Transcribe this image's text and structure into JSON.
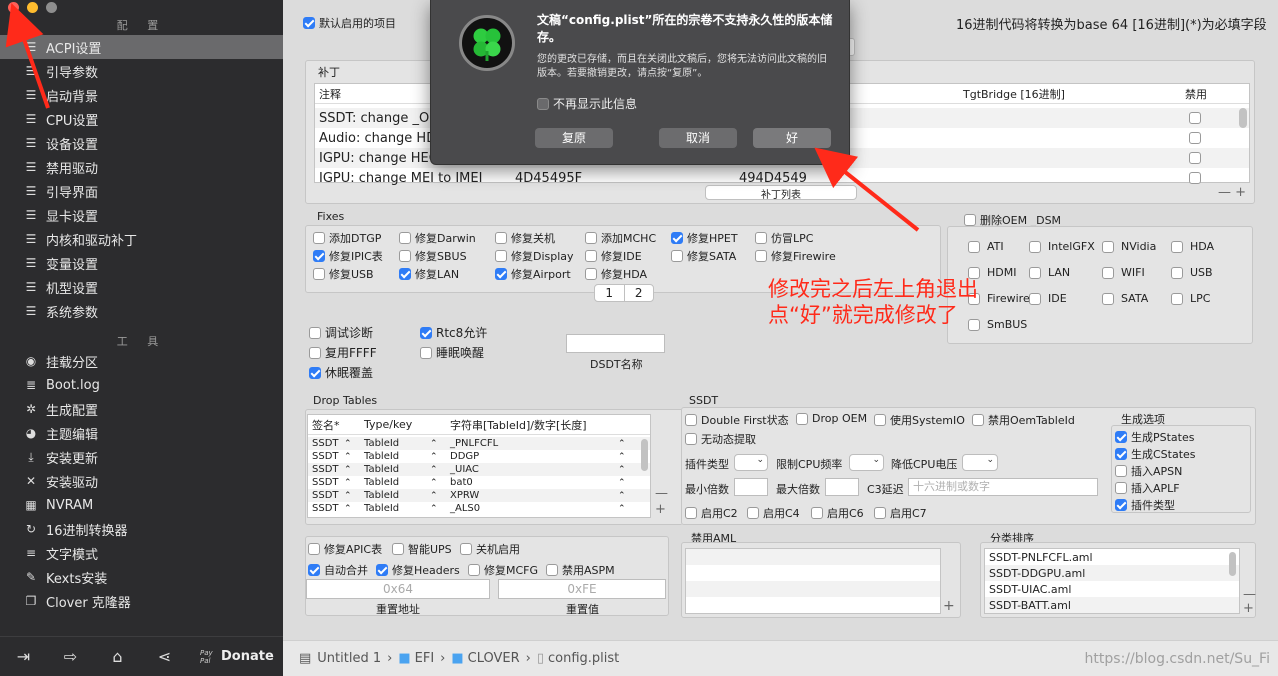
{
  "sidebar": {
    "config_header": "配 置",
    "tools_header": "工 具",
    "config_items": [
      {
        "icon": "list-icon",
        "label": "ACPI设置"
      },
      {
        "icon": "list-icon",
        "label": "引导参数"
      },
      {
        "icon": "list-icon",
        "label": "启动背景"
      },
      {
        "icon": "list-icon",
        "label": "CPU设置"
      },
      {
        "icon": "list-icon",
        "label": "设备设置"
      },
      {
        "icon": "list-icon",
        "label": "禁用驱动"
      },
      {
        "icon": "list-icon",
        "label": "引导界面"
      },
      {
        "icon": "list-icon",
        "label": "显卡设置"
      },
      {
        "icon": "list-icon",
        "label": "内核和驱动补丁"
      },
      {
        "icon": "list-icon",
        "label": "变量设置"
      },
      {
        "icon": "list-icon",
        "label": "机型设置"
      },
      {
        "icon": "list-icon",
        "label": "系统参数"
      }
    ],
    "tool_items": [
      {
        "icon": "disk-icon",
        "label": "挂载分区"
      },
      {
        "icon": "log-icon",
        "label": "Boot.log"
      },
      {
        "icon": "gear-wand-icon",
        "label": "生成配置"
      },
      {
        "icon": "palette-icon",
        "label": "主题编辑"
      },
      {
        "icon": "download-icon",
        "label": "安装更新"
      },
      {
        "icon": "tools-icon",
        "label": "安装驱动"
      },
      {
        "icon": "chip-icon",
        "label": "NVRAM"
      },
      {
        "icon": "refresh-icon",
        "label": "16进制转换器"
      },
      {
        "icon": "text-icon",
        "label": "文字模式"
      },
      {
        "icon": "wrench-icon",
        "label": "Kexts安装"
      },
      {
        "icon": "clone-icon",
        "label": "Clover 克隆器"
      }
    ],
    "bottom": {
      "donate_small": "Pay Pal",
      "donate": "Donate"
    }
  },
  "main": {
    "default_enable": "默认启用的项目",
    "hex_note": "16进制代码将转换为base 64 [16进制](*)为必填字段",
    "patches": {
      "title": "补丁",
      "col_comment": "注释",
      "col_tgt": "TgtBridge [16进制]",
      "col_disabled": "禁用",
      "rows": [
        {
          "comment": "SSDT: change _OS",
          "find": "",
          "replace": ""
        },
        {
          "comment": "Audio: change HDA",
          "find": "",
          "replace": ""
        },
        {
          "comment": "IGPU: change HEC",
          "find": "",
          "replace": ""
        },
        {
          "comment": "IGPU: change MEI to IMEI",
          "find": "4D45495F",
          "replace": "494D4549"
        }
      ],
      "list_button": "补丁列表"
    },
    "fixes": {
      "title": "Fixes",
      "items": [
        {
          "label": "添加DTGP",
          "on": false
        },
        {
          "label": "修复Darwin",
          "on": false
        },
        {
          "label": "修复关机",
          "on": false
        },
        {
          "label": "添加MCHC",
          "on": false
        },
        {
          "label": "修复HPET",
          "on": true
        },
        {
          "label": "仿冒LPC",
          "on": false
        },
        {
          "label": "修复IPIC表",
          "on": true
        },
        {
          "label": "修复SBUS",
          "on": false
        },
        {
          "label": "修复Display",
          "on": false
        },
        {
          "label": "修复IDE",
          "on": false
        },
        {
          "label": "修复SATA",
          "on": false
        },
        {
          "label": "修复Firewire",
          "on": false
        },
        {
          "label": "修复USB",
          "on": false
        },
        {
          "label": "修复LAN",
          "on": true
        },
        {
          "label": "修复Airport",
          "on": true
        },
        {
          "label": "修复HDA",
          "on": false
        }
      ],
      "page1": "1",
      "page2": "2"
    },
    "drop_oem": {
      "title": "删除OEM _DSM",
      "items": [
        "ATI",
        "IntelGFX",
        "NVidia",
        "HDA",
        "HDMI",
        "LAN",
        "WIFI",
        "USB",
        "Firewire",
        "IDE",
        "SATA",
        "LPC",
        "SmBUS"
      ]
    },
    "misc": {
      "debug": "调试诊断",
      "rtc8": "Rtc8允许",
      "reuse_ffff": "复用FFFF",
      "sleep_wake": "睡眠唤醒",
      "hibernate": "休眠覆盖",
      "dsdt_name_label": "DSDT名称"
    },
    "drop_tables": {
      "title": "Drop Tables",
      "col_sig": "签名*",
      "col_type": "Type/key",
      "col_str": "字符串[TableId]/数字[长度]",
      "rows": [
        {
          "sig": "SSDT",
          "type": "TableId",
          "str": "_PNLFCFL"
        },
        {
          "sig": "SSDT",
          "type": "TableId",
          "str": "DDGP"
        },
        {
          "sig": "SSDT",
          "type": "TableId",
          "str": "_UIAC"
        },
        {
          "sig": "SSDT",
          "type": "TableId",
          "str": "bat0"
        },
        {
          "sig": "SSDT",
          "type": "TableId",
          "str": "XPRW"
        },
        {
          "sig": "SSDT",
          "type": "TableId",
          "str": "_ALS0"
        }
      ]
    },
    "ssdt": {
      "title": "SSDT",
      "double_first": "Double First状态",
      "drop_oem": "Drop OEM",
      "use_system_io": "使用SystemIO",
      "disable_oem_table": "禁用OemTableId",
      "no_dynamic": "无动态提取",
      "plugin_type": "插件类型",
      "limit_cpu": "限制CPU频率",
      "lower_voltage": "降低CPU电压",
      "min_mult": "最小倍数",
      "max_mult": "最大倍数",
      "c3_latency": "C3延迟",
      "c3_placeholder": "十六进制或数字",
      "c2": "启用C2",
      "c4": "启用C4",
      "c6": "启用C6",
      "c7": "启用C7",
      "gen_title": "生成选项",
      "gen_items": [
        {
          "label": "生成PStates",
          "on": true
        },
        {
          "label": "生成CStates",
          "on": true
        },
        {
          "label": "插入APSN",
          "on": false
        },
        {
          "label": "插入APLF",
          "on": false
        },
        {
          "label": "插件类型",
          "on": true
        }
      ]
    },
    "bottom_left": {
      "fix_apic": "修复APIC表",
      "smart_ups": "智能UPS",
      "halt_enabler": "关机启用",
      "auto_merge": "自动合并",
      "fix_headers": "修复Headers",
      "fix_mcfg": "修复MCFG",
      "disable_aspm": "禁用ASPM",
      "addr_value": "0x64",
      "reset_value": "0xFE",
      "reset_addr_label": "重置地址",
      "reset_val_label": "重置值"
    },
    "disabled_aml": {
      "title": "禁用AML"
    },
    "sorted_order": {
      "title": "分类排序",
      "items": [
        "SSDT-PNLFCFL.aml",
        "SSDT-DDGPU.aml",
        "SSDT-UIAC.aml",
        "SSDT-BATT.aml"
      ]
    }
  },
  "status_bar": {
    "crumbs": [
      "Untitled 1",
      "EFI",
      "CLOVER",
      "config.plist"
    ],
    "watermark": "https://blog.csdn.net/Su_Fi"
  },
  "dialog": {
    "title": "文稿“config.plist”所在的宗卷不支持永久性的版本储存。",
    "body": "您的更改已存储，而且在关闭此文稿后，您将无法访问此文稿的旧版本。若要撤销更改，请点按“复原”。",
    "dont_show": "不再显示此信息",
    "revert": "复原",
    "cancel": "取消",
    "ok": "好"
  },
  "annotation": {
    "line1": "修改完之后左上角退出",
    "line2": "点“好”就完成修改了"
  },
  "colors": {
    "accent": "#2f7cf6",
    "sidebar": "#2c2c2e",
    "annotation": "#ff2a1a"
  }
}
